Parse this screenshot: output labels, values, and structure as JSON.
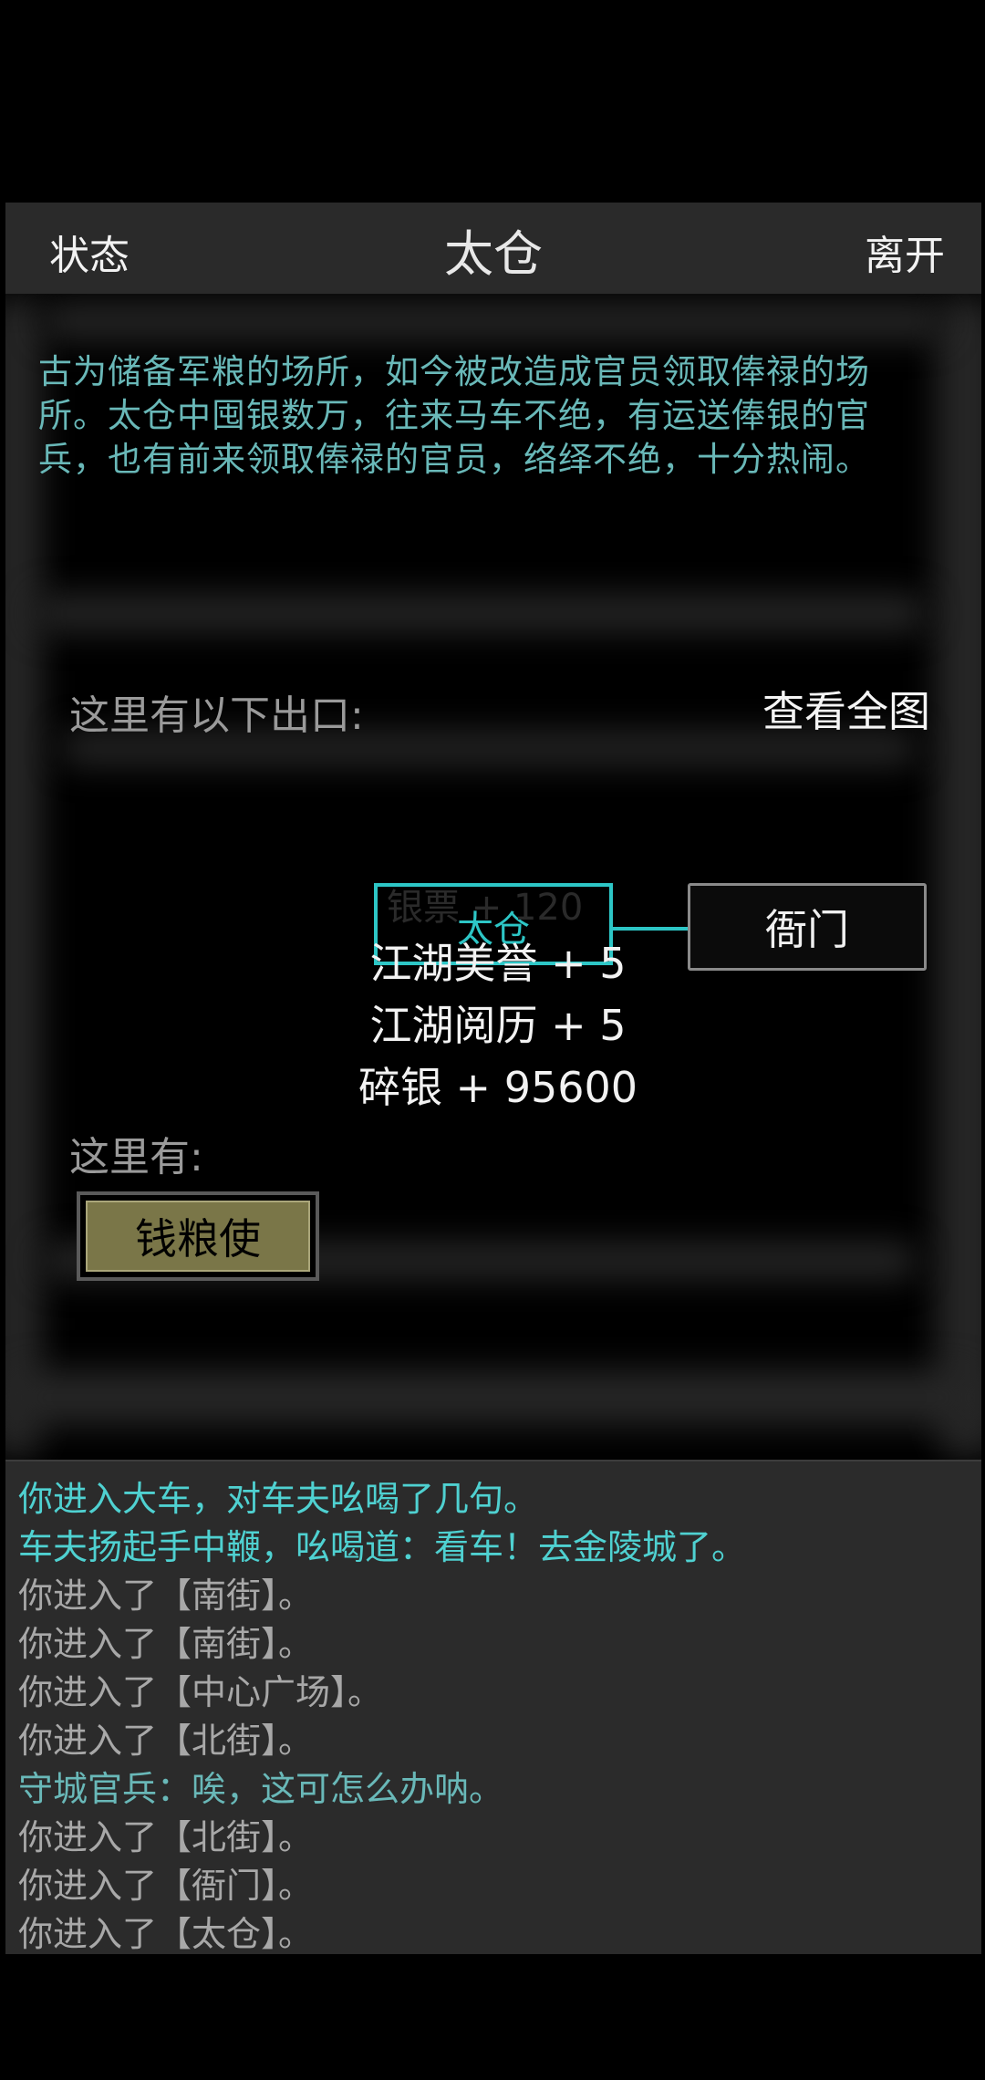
{
  "header": {
    "status_label": "状态",
    "title": "太仓",
    "leave_label": "离开"
  },
  "description": "古为储备军粮的场所，如今被改造成官员领取俸禄的场所。太仓中囤银数万，往来马车不绝，有运送俸银的官兵，也有前来领取俸禄的官员，络绎不绝，十分热闹。",
  "exits": {
    "label": "这里有以下出口:",
    "view_map_label": "查看全图"
  },
  "map": {
    "current_room": "太仓",
    "east_exit": "衙门"
  },
  "rewards": {
    "faded": "银票 + 120",
    "lines": [
      "江湖美誉 + 5",
      "江湖阅历 + 5",
      "碎银 + 95600"
    ]
  },
  "here": {
    "label": "这里有:",
    "npcs": [
      "钱粮使"
    ]
  },
  "log": [
    {
      "text": "你进入大车，对车夫吆喝了几句。",
      "color": "#4fd1d1"
    },
    {
      "text": "车夫扬起手中鞭，吆喝道：看车！去金陵城了。",
      "color": "#4fd1d1"
    },
    {
      "text": "你进入了【南街】。",
      "color": "#a8a8a8"
    },
    {
      "text": "你进入了【南街】。",
      "color": "#a8a8a8"
    },
    {
      "text": "你进入了【中心广场】。",
      "color": "#a8a8a8"
    },
    {
      "text": "你进入了【北街】。",
      "color": "#a8a8a8"
    },
    {
      "text": "守城官兵：唉，这可怎么办呐。",
      "color": "#69b8b8"
    },
    {
      "text": "你进入了【北街】。",
      "color": "#a8a8a8"
    },
    {
      "text": "你进入了【衙门】。",
      "color": "#a8a8a8"
    },
    {
      "text": "你进入了【太仓】。",
      "color": "#a8a8a8"
    }
  ]
}
